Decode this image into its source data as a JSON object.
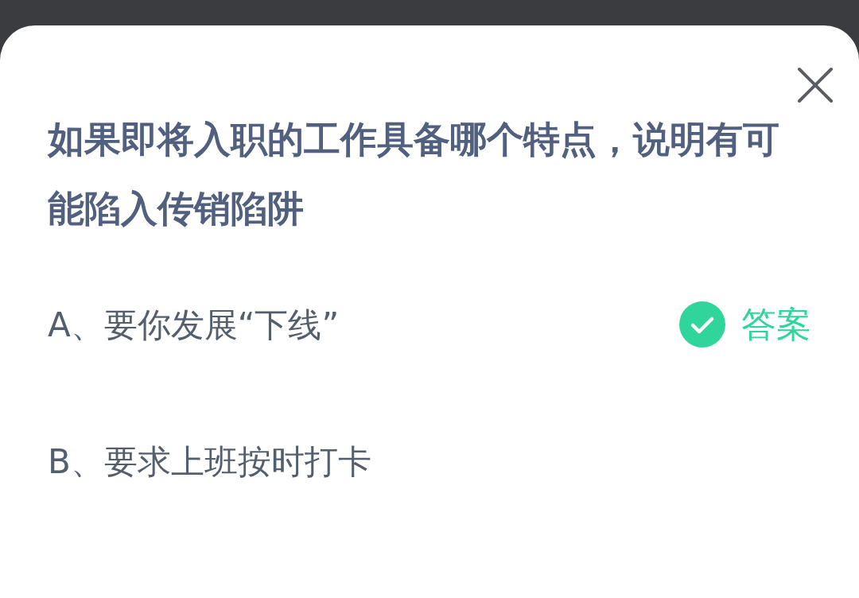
{
  "question": "如果即将入职的工作具备哪个特点，说明有可能陷入传销陷阱",
  "options": [
    {
      "text": "A、要你发展“下线”",
      "correct": true
    },
    {
      "text": "B、要求上班按时打卡",
      "correct": false
    }
  ],
  "answer_label": "答案"
}
